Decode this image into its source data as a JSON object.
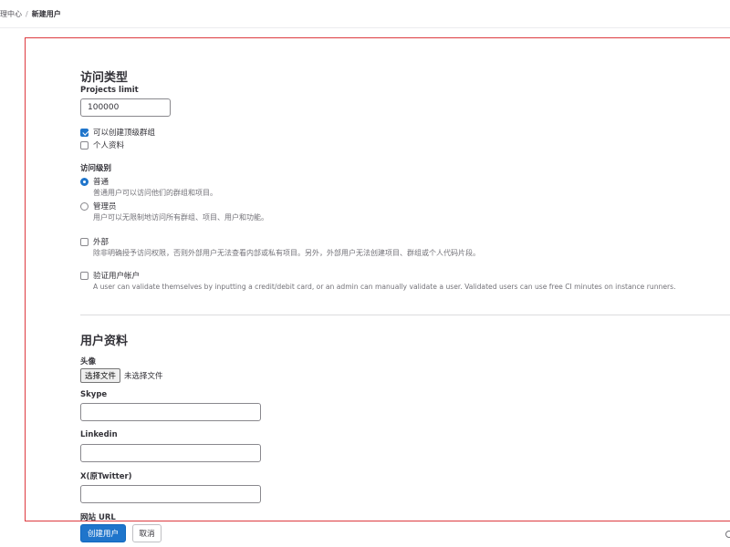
{
  "breadcrumb": {
    "parent": "理中心",
    "separator": "/",
    "current": "新建用户"
  },
  "access": {
    "title": "访问类型",
    "projects_limit_label": "Projects limit",
    "projects_limit_value": "100000",
    "can_create_group_label": "可以创建顶级群组",
    "can_create_group_checked": true,
    "private_profile_label": "个人资料",
    "private_profile_checked": false,
    "level_label": "访问级别",
    "regular_label": "普通",
    "regular_help": "普通用户可以访问他们的群组和项目。",
    "regular_selected": true,
    "admin_label": "管理员",
    "admin_help": "用户可以无限制地访问所有群组、项目、用户和功能。",
    "external_label": "外部",
    "external_help": "除非明确授予访问权限，否则外部用户无法查看内部或私有项目。另外，外部用户无法创建项目、群组或个人代码片段。",
    "validate_label": "验证用户帐户",
    "validate_help": "A user can validate themselves by inputting a credit/debit card, or an admin can manually validate a user. Validated users can use free CI minutes on instance runners."
  },
  "profile": {
    "title": "用户资料",
    "avatar_label": "头像",
    "file_button": "选择文件",
    "file_status": "未选择文件",
    "skype_label": "Skype",
    "linkedin_label": "Linkedin",
    "twitter_label": "X(原Twitter)",
    "website_label": "网站 URL"
  },
  "actions": {
    "create": "创建用户",
    "cancel": "取消"
  },
  "colors": {
    "primary": "#1f75cb",
    "highlight_border": "#dd3a3f"
  }
}
